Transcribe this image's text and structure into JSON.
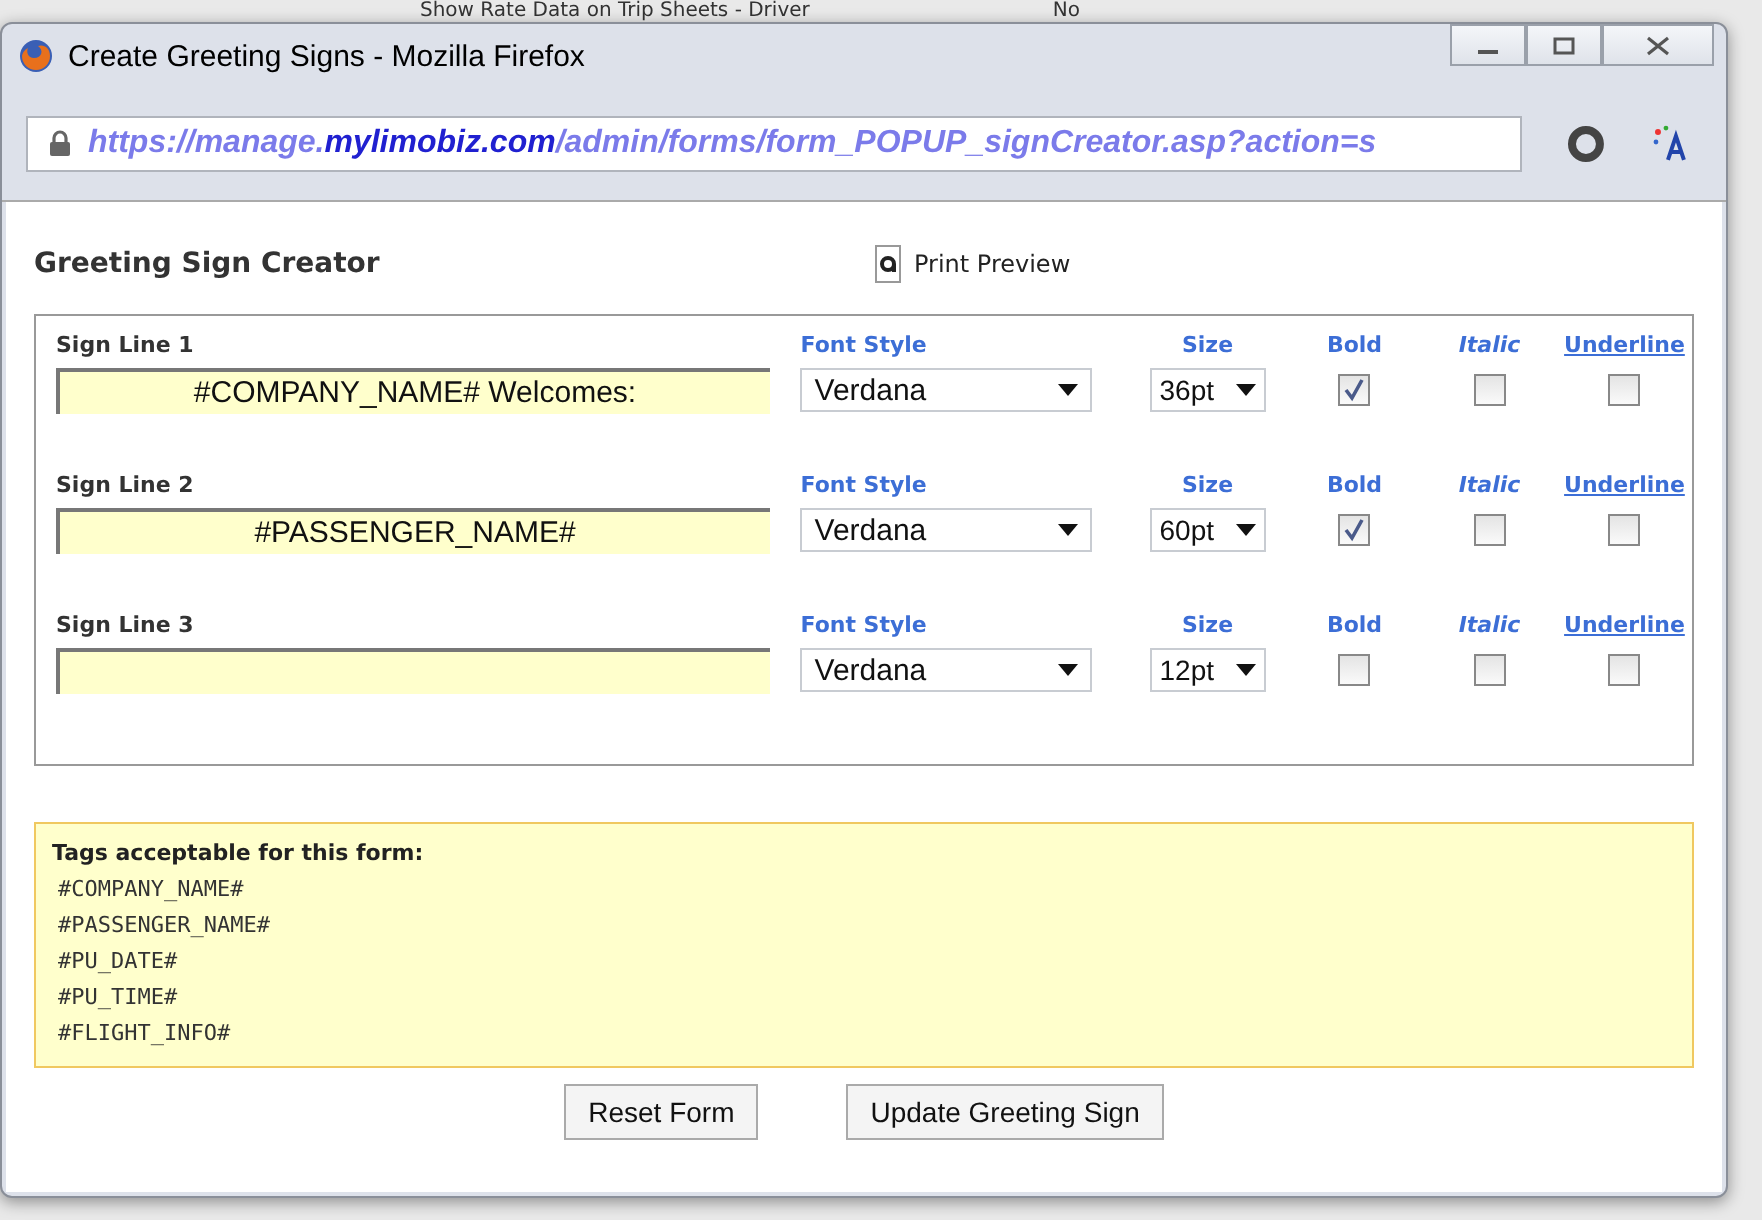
{
  "background_page": {
    "label": "Show Rate Data on Trip Sheets - Driver",
    "value": "No"
  },
  "window": {
    "title": "Create Greeting Signs - Mozilla Firefox"
  },
  "address_bar": {
    "scheme_host": "https://manage.",
    "domain": "mylimobiz.com",
    "path": "/admin/forms/form_POPUP_signCreator.asp?action=s"
  },
  "page": {
    "heading": "Greeting Sign Creator",
    "print_preview": "Print Preview"
  },
  "sign_lines": [
    {
      "label": "Sign Line 1",
      "value": "#COMPANY_NAME# Welcomes:",
      "font_style_label": "Font Style",
      "font": "Verdana",
      "size_label": "Size",
      "size": "36pt",
      "bold_label": "Bold",
      "bold": true,
      "italic_label": "Italic",
      "italic": false,
      "underline_label": "Underline",
      "underline": false
    },
    {
      "label": "Sign Line 2",
      "value": "#PASSENGER_NAME#",
      "font_style_label": "Font Style",
      "font": "Verdana",
      "size_label": "Size",
      "size": "60pt",
      "bold_label": "Bold",
      "bold": true,
      "italic_label": "Italic",
      "italic": false,
      "underline_label": "Underline",
      "underline": false
    },
    {
      "label": "Sign Line 3",
      "font_style_label": "Font Style",
      "font": "Verdana",
      "size_label": "Size",
      "size": "12pt",
      "bold_label": "Bold",
      "bold": false,
      "italic_label": "Italic",
      "italic": false,
      "underline_label": "Underline",
      "underline": false
    }
  ],
  "tags": {
    "heading": "Tags acceptable for this form:",
    "items": [
      "#COMPANY_NAME#",
      "#PASSENGER_NAME#",
      "#PU_DATE#",
      "#PU_TIME#",
      "#FLIGHT_INFO#"
    ]
  },
  "buttons": [
    "Reset Form",
    "Update Greeting Sign"
  ]
}
